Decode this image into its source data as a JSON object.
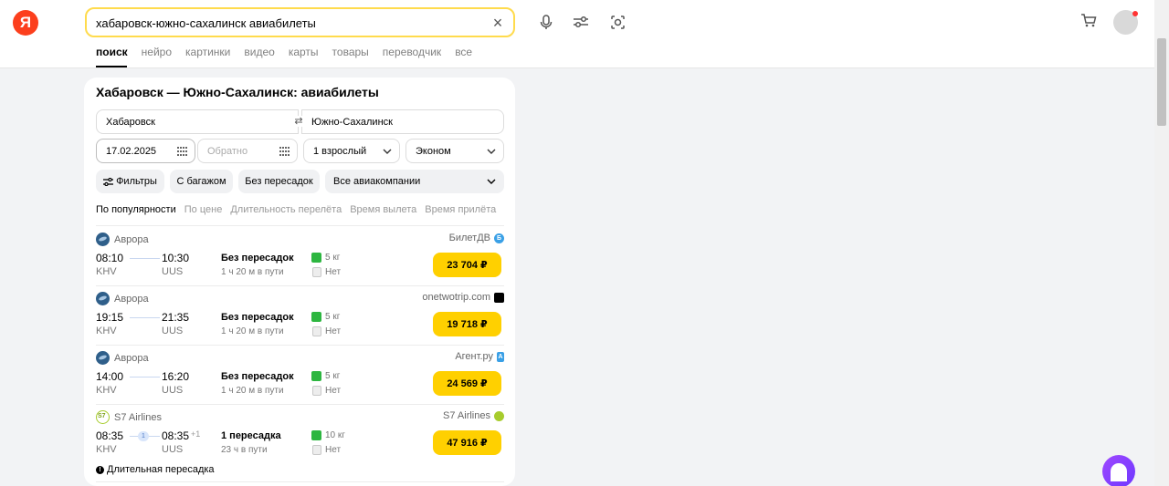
{
  "header": {
    "logo": "Я",
    "search_value": "хабаровск-южно-сахалинск авиабилеты",
    "icons": {
      "clear": "close-icon",
      "voice": "microphone-icon",
      "settings": "sliders-icon",
      "lens": "camera-lens-icon",
      "cart": "cart-icon",
      "avatar": "avatar"
    }
  },
  "tabs": [
    "поиск",
    "нейро",
    "картинки",
    "видео",
    "карты",
    "товары",
    "переводчик",
    "все"
  ],
  "widget": {
    "title": "Хабаровск — Южно-Сахалинск: авиабилеты",
    "from": "Хабаровск",
    "to": "Южно-Сахалинск",
    "date": "17.02.2025",
    "return_placeholder": "Обратно",
    "passengers": "1 взрослый",
    "class": "Эконом",
    "chips": {
      "filters": "Фильтры",
      "baggage": "С багажом",
      "nonstop": "Без пересадок",
      "airlines": "Все авиакомпании"
    },
    "sorts": [
      "По популярности",
      "По цене",
      "Длительность перелёта",
      "Время вылета",
      "Время прилёта"
    ]
  },
  "flights": [
    {
      "airline": "Аврора",
      "agency": "БилетДВ",
      "dep_time": "08:10",
      "dep_code": "KHV",
      "arr_time": "10:30",
      "arr_code": "UUS",
      "stops": "Без пересадок",
      "duration": "1 ч 20 м в пути",
      "bag": "5 кг",
      "nobag": "Нет",
      "price": "23 704 ₽"
    },
    {
      "airline": "Аврора",
      "agency": "onetwotrip.com",
      "dep_time": "19:15",
      "dep_code": "KHV",
      "arr_time": "21:35",
      "arr_code": "UUS",
      "stops": "Без пересадок",
      "duration": "1 ч 20 м в пути",
      "bag": "5 кг",
      "nobag": "Нет",
      "price": "19 718 ₽"
    },
    {
      "airline": "Аврора",
      "agency": "Агент.ру",
      "dep_time": "14:00",
      "dep_code": "KHV",
      "arr_time": "16:20",
      "arr_code": "UUS",
      "stops": "Без пересадок",
      "duration": "1 ч 20 м в пути",
      "bag": "5 кг",
      "nobag": "Нет",
      "price": "24 569 ₽"
    },
    {
      "airline": "S7 Airlines",
      "agency": "S7 Airlines",
      "dep_time": "08:35",
      "dep_code": "KHV",
      "arr_time": "08:35",
      "arr_code": "UUS",
      "day_offset": "+1",
      "stop_count": "1",
      "stops": "1 пересадка",
      "duration": "23 ч в пути",
      "bag": "10 кг",
      "nobag": "Нет",
      "price": "47 916 ₽",
      "warning": "Длительная пересадка"
    }
  ],
  "colors": {
    "accent_yellow": "#ffd000",
    "search_border": "#ffdb4d",
    "logo_red": "#fc3f1d",
    "bag_green": "#2db640"
  }
}
